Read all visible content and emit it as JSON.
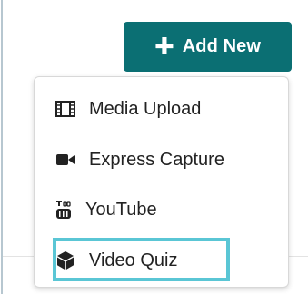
{
  "header": {
    "add_new_button": {
      "icon": "plus-icon",
      "label": "Add New"
    }
  },
  "dropdown": {
    "items": [
      {
        "label": "Media Upload",
        "icon": "film-icon"
      },
      {
        "label": "Express Capture",
        "icon": "video-camera-icon"
      },
      {
        "label": "YouTube",
        "icon": "youtube-icon"
      },
      {
        "label": "Video Quiz",
        "icon": "cube-icon",
        "highlighted": true
      }
    ]
  },
  "colors": {
    "button_bg": "#0b6f73",
    "highlight_border": "#5ac6d5",
    "text": "#222222"
  }
}
